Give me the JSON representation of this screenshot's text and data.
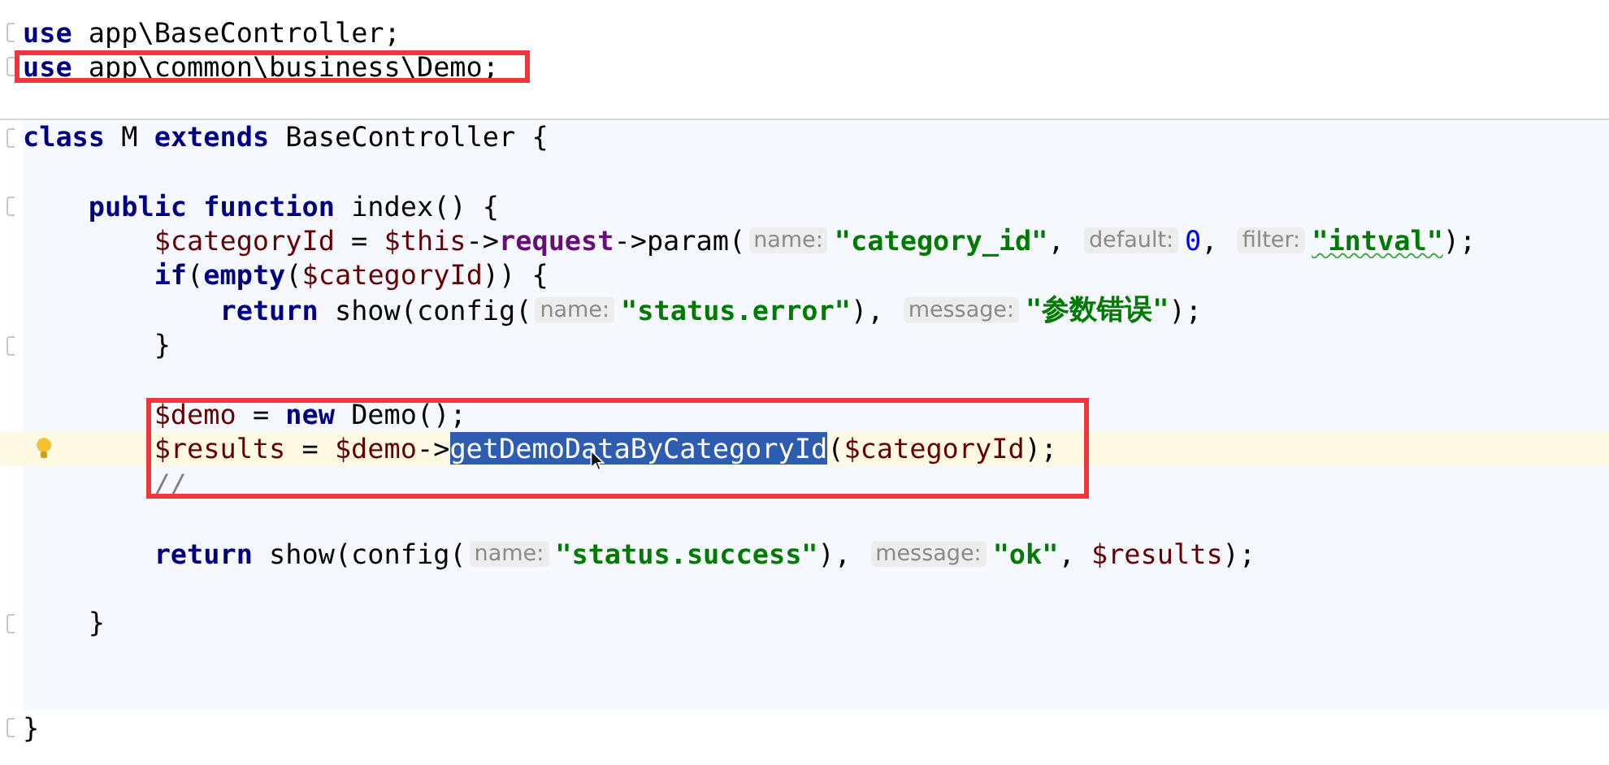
{
  "editor": {
    "lines": [
      {
        "kind": "code",
        "fold": true,
        "tokens": [
          {
            "kind": "kw",
            "text": "use"
          },
          {
            "kind": "text",
            "text": " app\\BaseController;"
          }
        ]
      },
      {
        "kind": "code",
        "fold": true,
        "boxed": true,
        "tokens": [
          {
            "kind": "kw",
            "text": "use"
          },
          {
            "kind": "text",
            "text": " app\\common\\business\\Demo;"
          }
        ]
      },
      {
        "kind": "blank"
      },
      {
        "kind": "class",
        "fold": true,
        "tokens": [
          {
            "kind": "kw",
            "text": "class"
          },
          {
            "kind": "text",
            "text": " M "
          },
          {
            "kind": "kw",
            "text": "extends"
          },
          {
            "kind": "text",
            "text": " BaseController {"
          }
        ],
        "children": [
          {
            "kind": "blank"
          },
          {
            "kind": "code",
            "fold": true,
            "tokens": [
              {
                "kind": "kw",
                "text": "public"
              },
              {
                "kind": "kw",
                "text": " function"
              },
              {
                "kind": "text",
                "text": " index() {"
              }
            ],
            "children": [
              {
                "kind": "code",
                "tokens": [
                  {
                    "kind": "var",
                    "text": "$categoryId"
                  },
                  {
                    "kind": "text",
                    "text": " = "
                  },
                  {
                    "kind": "var",
                    "text": "$this"
                  },
                  {
                    "kind": "text",
                    "text": "->"
                  },
                  {
                    "kind": "method",
                    "text": "request"
                  },
                  {
                    "kind": "text",
                    "text": "->param("
                  },
                  {
                    "kind": "hint",
                    "text": "name:"
                  },
                  {
                    "kind": "str",
                    "text": "\"category_id\""
                  },
                  {
                    "kind": "text",
                    "text": ", "
                  },
                  {
                    "kind": "hint",
                    "text": "default:"
                  },
                  {
                    "kind": "num",
                    "text": "0"
                  },
                  {
                    "kind": "text",
                    "text": ", "
                  },
                  {
                    "kind": "hint",
                    "text": "filter:"
                  },
                  {
                    "kind": "str",
                    "text": "\"intval\"",
                    "squiggle": true
                  },
                  {
                    "kind": "text",
                    "text": ");"
                  }
                ]
              },
              {
                "kind": "code",
                "tokens": [
                  {
                    "kind": "kw",
                    "text": "if"
                  },
                  {
                    "kind": "text",
                    "text": "("
                  },
                  {
                    "kind": "kw",
                    "text": "empty"
                  },
                  {
                    "kind": "text",
                    "text": "("
                  },
                  {
                    "kind": "var",
                    "text": "$categoryId"
                  },
                  {
                    "kind": "text",
                    "text": ")) {"
                  }
                ],
                "children": [
                  {
                    "kind": "code",
                    "tokens": [
                      {
                        "kind": "kw",
                        "text": "return"
                      },
                      {
                        "kind": "text",
                        "text": " show(config("
                      },
                      {
                        "kind": "hint",
                        "text": "name:"
                      },
                      {
                        "kind": "str",
                        "text": "\"status.error\""
                      },
                      {
                        "kind": "text",
                        "text": "), "
                      },
                      {
                        "kind": "hint",
                        "text": "message:"
                      },
                      {
                        "kind": "str",
                        "text": "\"参数错误\""
                      },
                      {
                        "kind": "text",
                        "text": ");"
                      }
                    ]
                  }
                ]
              },
              {
                "kind": "code",
                "fold": true,
                "tokens": [
                  {
                    "kind": "text",
                    "text": "}"
                  }
                ]
              },
              {
                "kind": "blank"
              },
              {
                "kind": "code",
                "boxed": true,
                "tokens": [
                  {
                    "kind": "var",
                    "text": "$demo"
                  },
                  {
                    "kind": "text",
                    "text": " = "
                  },
                  {
                    "kind": "kw",
                    "text": "new"
                  },
                  {
                    "kind": "text",
                    "text": " Demo();"
                  }
                ]
              },
              {
                "kind": "code",
                "boxed": true,
                "current": true,
                "bulb": true,
                "tokens": [
                  {
                    "kind": "var",
                    "text": "$results"
                  },
                  {
                    "kind": "text",
                    "text": " = "
                  },
                  {
                    "kind": "var",
                    "text": "$demo"
                  },
                  {
                    "kind": "text",
                    "text": "->"
                  },
                  {
                    "kind": "sel",
                    "text": "getDemoDataByCategoryId"
                  },
                  {
                    "kind": "text",
                    "text": "("
                  },
                  {
                    "kind": "var",
                    "text": "$categoryId"
                  },
                  {
                    "kind": "text",
                    "text": ");"
                  }
                ]
              },
              {
                "kind": "code",
                "boxed": true,
                "tokens": [
                  {
                    "kind": "comment",
                    "text": "//"
                  }
                ]
              },
              {
                "kind": "blank"
              },
              {
                "kind": "code",
                "tokens": [
                  {
                    "kind": "kw",
                    "text": "return"
                  },
                  {
                    "kind": "text",
                    "text": " show(config("
                  },
                  {
                    "kind": "hint",
                    "text": "name:"
                  },
                  {
                    "kind": "str",
                    "text": "\"status.success\""
                  },
                  {
                    "kind": "text",
                    "text": "), "
                  },
                  {
                    "kind": "hint",
                    "text": "message:"
                  },
                  {
                    "kind": "str",
                    "text": "\"ok\""
                  },
                  {
                    "kind": "text",
                    "text": ", "
                  },
                  {
                    "kind": "var",
                    "text": "$results"
                  },
                  {
                    "kind": "text",
                    "text": ");"
                  }
                ]
              },
              {
                "kind": "blank"
              }
            ]
          },
          {
            "kind": "code",
            "fold": true,
            "tokens": [
              {
                "kind": "text",
                "text": "}"
              }
            ]
          },
          {
            "kind": "blank"
          },
          {
            "kind": "blank"
          }
        ]
      },
      {
        "kind": "code",
        "fold": true,
        "tokens": [
          {
            "kind": "text",
            "text": "}"
          }
        ]
      }
    ]
  }
}
